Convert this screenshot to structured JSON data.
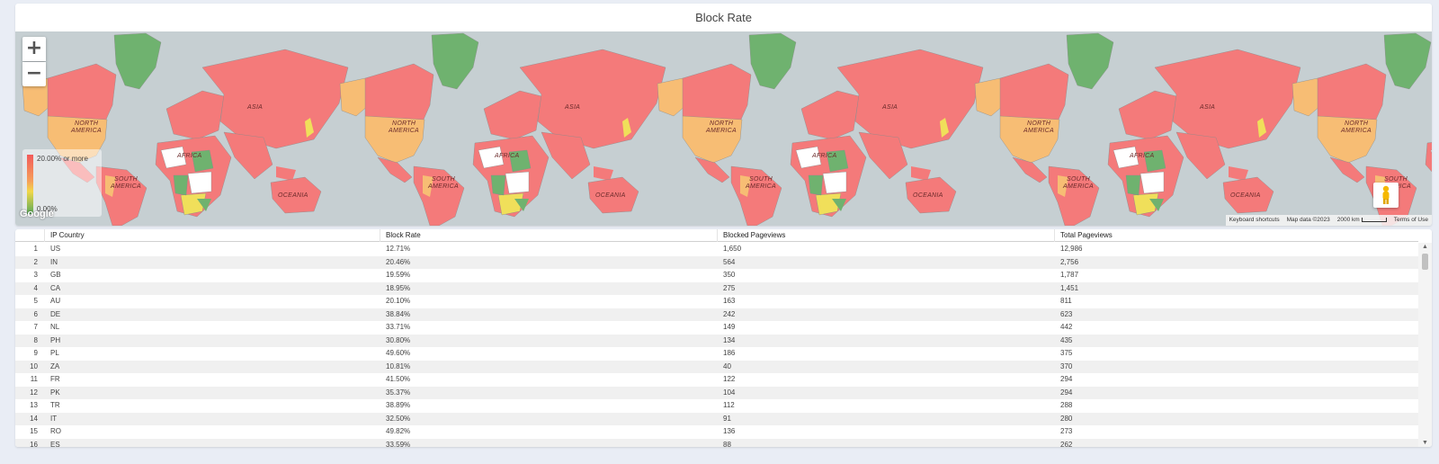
{
  "map": {
    "title": "Block Rate",
    "zoom_in_label": "+",
    "zoom_out_label": "−",
    "continent_labels": [
      "ASIA",
      "NORTH",
      "AMERICA",
      "AFRICA",
      "SOUTH",
      "AMERICA",
      "OCEANIA"
    ],
    "legend": {
      "max_label": "20.00% or more",
      "min_label": "0.00%"
    },
    "brand": "Google",
    "attribution": {
      "shortcuts": "Keyboard shortcuts",
      "map_data": "Map data ©2023",
      "scale": "2000 km",
      "terms": "Terms of Use"
    },
    "colors": {
      "ocean": "#c6cfd2",
      "high": "#f47a7a",
      "mid": "#f7bd74",
      "low_mid": "#f0df5a",
      "low": "#6fb26f",
      "none": "#ffffff"
    }
  },
  "table": {
    "columns": [
      "IP Country",
      "Block Rate",
      "Blocked Pageviews",
      "Total Pageviews"
    ],
    "rows": [
      [
        "1",
        "US",
        "12.71%",
        "1,650",
        "12,986"
      ],
      [
        "2",
        "IN",
        "20.46%",
        "564",
        "2,756"
      ],
      [
        "3",
        "GB",
        "19.59%",
        "350",
        "1,787"
      ],
      [
        "4",
        "CA",
        "18.95%",
        "275",
        "1,451"
      ],
      [
        "5",
        "AU",
        "20.10%",
        "163",
        "811"
      ],
      [
        "6",
        "DE",
        "38.84%",
        "242",
        "623"
      ],
      [
        "7",
        "NL",
        "33.71%",
        "149",
        "442"
      ],
      [
        "8",
        "PH",
        "30.80%",
        "134",
        "435"
      ],
      [
        "9",
        "PL",
        "49.60%",
        "186",
        "375"
      ],
      [
        "10",
        "ZA",
        "10.81%",
        "40",
        "370"
      ],
      [
        "11",
        "FR",
        "41.50%",
        "122",
        "294"
      ],
      [
        "12",
        "PK",
        "35.37%",
        "104",
        "294"
      ],
      [
        "13",
        "TR",
        "38.89%",
        "112",
        "288"
      ],
      [
        "14",
        "IT",
        "32.50%",
        "91",
        "280"
      ],
      [
        "15",
        "RO",
        "49.82%",
        "136",
        "273"
      ],
      [
        "16",
        "ES",
        "33.59%",
        "88",
        "262"
      ]
    ]
  }
}
